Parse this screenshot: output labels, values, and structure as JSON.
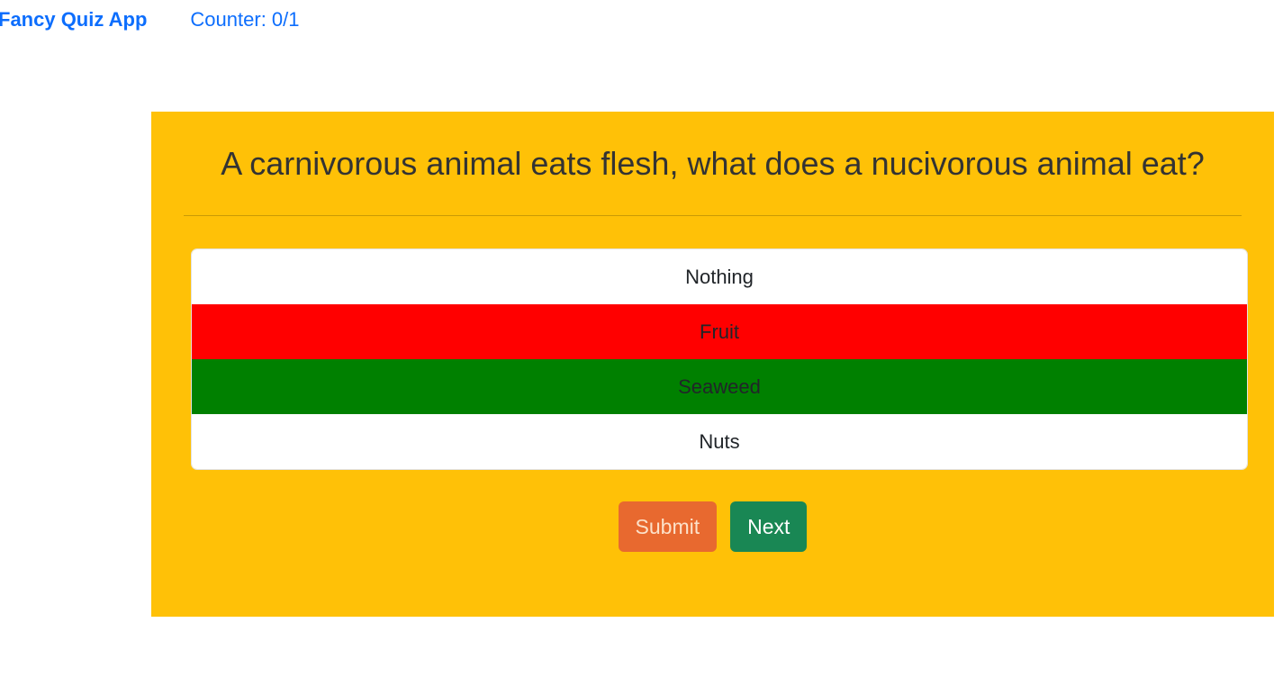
{
  "nav": {
    "brand": "Fancy Quiz App",
    "counter": "Counter: 0/1"
  },
  "quiz": {
    "question": "A carnivorous animal eats flesh, what does a nucivorous animal eat?",
    "answers": [
      {
        "label": "Nothing",
        "state": "default"
      },
      {
        "label": "Fruit",
        "state": "incorrect"
      },
      {
        "label": "Seaweed",
        "state": "correct"
      },
      {
        "label": "Nuts",
        "state": "default"
      }
    ],
    "submit_label": "Submit",
    "next_label": "Next"
  },
  "colors": {
    "link": "#0d6efd",
    "card_background": "#ffc107",
    "incorrect": "#ff0000",
    "correct": "#008000",
    "submit_button": "#e8692f",
    "next_button": "#198754"
  }
}
